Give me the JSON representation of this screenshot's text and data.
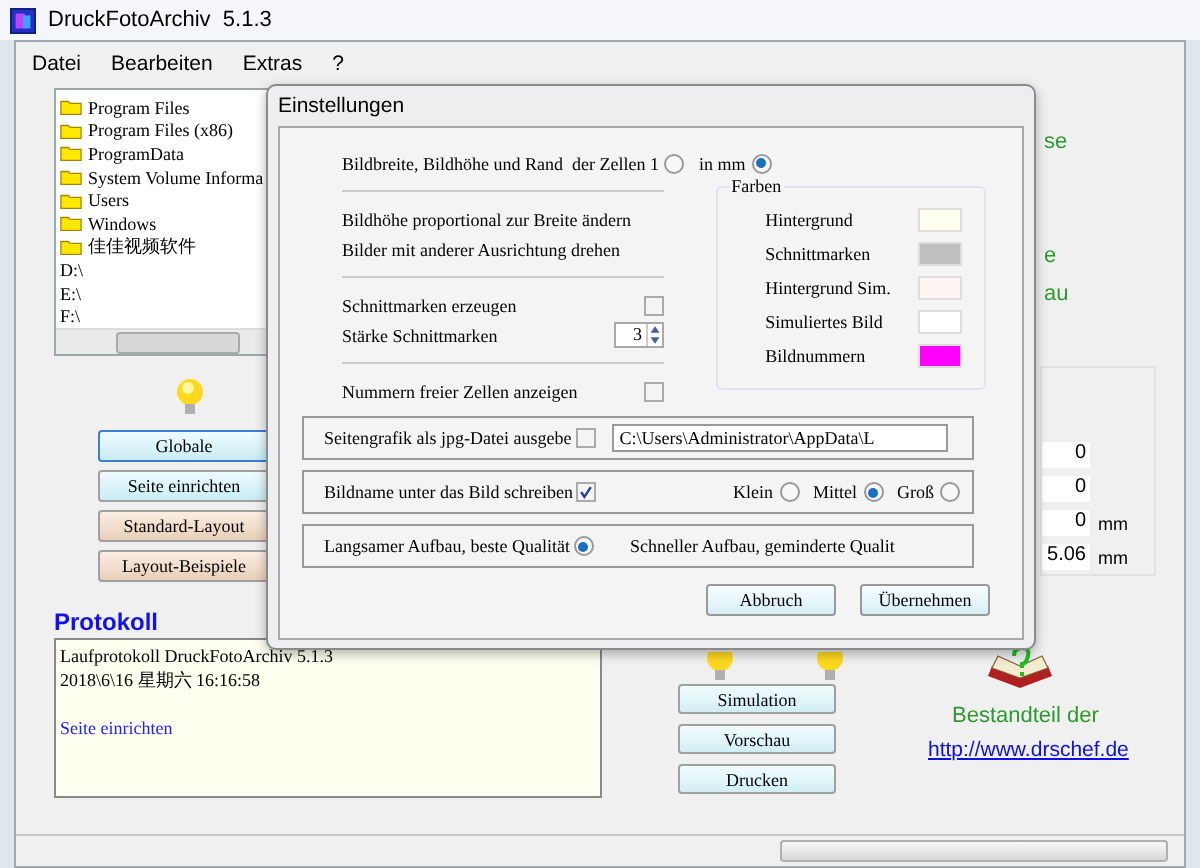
{
  "window": {
    "title": "DruckFotoArchiv  5.1.3"
  },
  "menu": [
    "Datei",
    "Bearbeiten",
    "Extras",
    "?"
  ],
  "tree": [
    {
      "label": "Program Files",
      "kind": "folder"
    },
    {
      "label": "Program Files (x86)",
      "kind": "folder"
    },
    {
      "label": "ProgramData",
      "kind": "folder"
    },
    {
      "label": "System Volume Informa",
      "kind": "folder"
    },
    {
      "label": "Users",
      "kind": "folder"
    },
    {
      "label": "Windows",
      "kind": "folder"
    },
    {
      "label": "佳佳视频软件",
      "kind": "folder"
    },
    {
      "label": "D:\\",
      "kind": "drive"
    },
    {
      "label": "E:\\",
      "kind": "drive"
    },
    {
      "label": "F:\\",
      "kind": "drive"
    }
  ],
  "side_buttons": [
    {
      "label": "Globale",
      "kind": "settings",
      "selected": true
    },
    {
      "label": "Seite einrichten",
      "kind": "settings",
      "selected": false
    },
    {
      "label": "Standard-Layout",
      "kind": "layout",
      "selected": false
    },
    {
      "label": "Layout-Beispiele",
      "kind": "layout",
      "selected": false
    }
  ],
  "protocol": {
    "title": "Protokoll",
    "lines": [
      {
        "text": "Laufprotokoll DruckFotoArchiv 5.1.3",
        "kind": "plain"
      },
      {
        "text": "2018\\6\\16 星期六 16:16:58",
        "kind": "plain"
      },
      {
        "text": "Seite einrichten",
        "kind": "highlight"
      }
    ]
  },
  "action_buttons": [
    "Simulation",
    "Vorschau",
    "Drucken"
  ],
  "right_panel": {
    "partial_labels": [
      "se",
      "e",
      "au"
    ],
    "fields": [
      {
        "value": "0"
      },
      {
        "value": "0"
      },
      {
        "value": "0",
        "unit": "mm"
      },
      {
        "value": "5.06",
        "unit": "mm"
      }
    ],
    "caption": "Bestandteil der",
    "link": "http://www.drschef.de"
  },
  "dialog": {
    "title": "Einstellungen",
    "size_options": [
      {
        "label": "Bildbreite, Bildhöhe und Rand  der Zellen 1",
        "selected": false
      },
      {
        "label": "in mm",
        "selected": true
      }
    ],
    "options": [
      "Bildhöhe proportional zur Breite ändern",
      "Bilder mit anderer Ausrichtung drehen"
    ],
    "marks": {
      "label": "Schnittmarken erzeugen",
      "checked": false
    },
    "mark_strength": {
      "label": "Stärke Schnittmarken",
      "value": "3"
    },
    "free_numbers": {
      "label": "Nummern freier Zellen anzeigen",
      "checked": false
    },
    "colors": {
      "title": "Farben",
      "items": [
        {
          "label": "Hintergrund",
          "color": "#fffff0"
        },
        {
          "label": "Schnittmarken",
          "color": "#c0c0c0"
        },
        {
          "label": "Hintergrund Sim.",
          "color": "#fff5f5"
        },
        {
          "label": "Simuliertes Bild",
          "color": "#ffffff"
        },
        {
          "label": "Bildnummern",
          "color": "#ff00ff"
        }
      ]
    },
    "export": {
      "label": "Seitengrafik als jpg-Datei ausgebe",
      "checked": false,
      "path": "C:\\Users\\Administrator\\AppData\\L"
    },
    "caption": {
      "label": "Bildname unter das Bild schreiben",
      "checked": true,
      "sizes": [
        {
          "label": "Klein",
          "selected": false
        },
        {
          "label": "Mittel",
          "selected": true
        },
        {
          "label": "Groß",
          "selected": false
        }
      ]
    },
    "quality": {
      "slow": {
        "label": "Langsamer Aufbau, beste Qualität",
        "selected": true
      },
      "fast_label": "Schneller Aufbau, geminderte Qualit"
    },
    "buttons": [
      "Abbruch",
      "Übernehmen"
    ]
  }
}
